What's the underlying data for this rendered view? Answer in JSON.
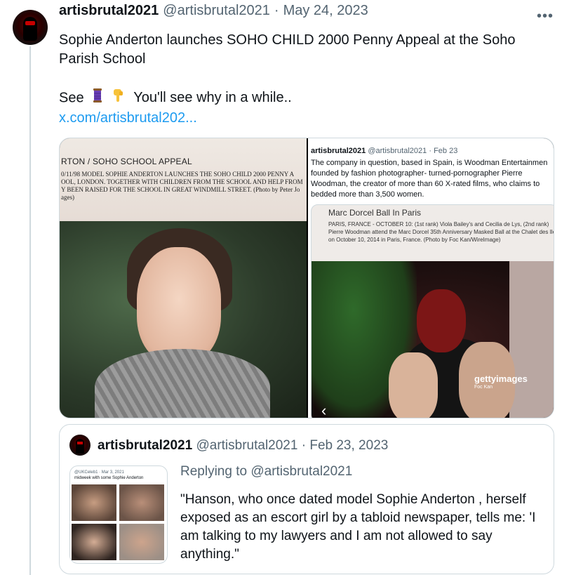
{
  "tweet": {
    "display_name": "artisbrutal2021",
    "handle": "@artisbrutal2021",
    "dot": "·",
    "date": "May 24, 2023",
    "more_icon": "more-icon",
    "line1": "Sophie Anderton launches SOHO CHILD 2000 Penny Appeal at the Soho Parish School",
    "line2_prefix": "See",
    "line2_emojis": [
      "thread-spool-icon",
      "pointing-down-icon"
    ],
    "line2_suffix": "You'll see why in a while..",
    "link": "x.com/artisbrutal202..."
  },
  "media": {
    "left": {
      "banner_title": "RTON / SOHO SCHOOL APPEAL",
      "banner_caption": "0/11/98 MODEL SOPHIE ANDERTON LAUNCHES THE SOHO CHILD 2000 PENNY A OOL, LONDON. TOGETHER WITH CHILDREN FROM THE SCHOOL AND HELP FROM Y BEEN RAISED FOR THE SCHOOL IN GREAT WINDMILL STREET. (Photo by Peter Jo ages)"
    },
    "right": {
      "author": "artisbrutal2021",
      "handle": "@artisbrutal2021",
      "date": "Feb 23",
      "body": "The company in question, based in Spain, is Woodman Entertainmen founded by fashion photographer- turned-pornographer Pierre Woodman, the creator of more than 60 X-rated films, who claims to bedded more than 3,500 women.",
      "card_title": "Marc Dorcel Ball In Paris",
      "card_caption": "PARIS, FRANCE - OCTOBER 10: (1st rank) Viola Bailey's and Cecilia de Lys, (2nd rank) Pierre Woodman attend the Marc Dorcel 35th Anniversary Masked Ball at the Chalet des Iles on October 10, 2014 in Paris, France. (Photo by Foc Kan/WireImage)",
      "watermark": "gettyimages",
      "watermark_sub": "Foc Kan"
    }
  },
  "quote": {
    "display_name": "artisbrutal2021",
    "handle": "@artisbrutal2021",
    "dot": "·",
    "date": "Feb 23, 2023",
    "thumb_line1": "@UKCeleb1 · Mar 3, 2021",
    "thumb_line2": "midweek with some Sophie Anderton",
    "replying_prefix": "Replying to",
    "replying_to": "@artisbrutal2021",
    "body": "\"Hanson, who once dated model Sophie Anderton , herself exposed as an escort girl by a tabloid newspaper, tells me: 'I am talking to my lawyers and I am not allowed to say anything.\""
  }
}
